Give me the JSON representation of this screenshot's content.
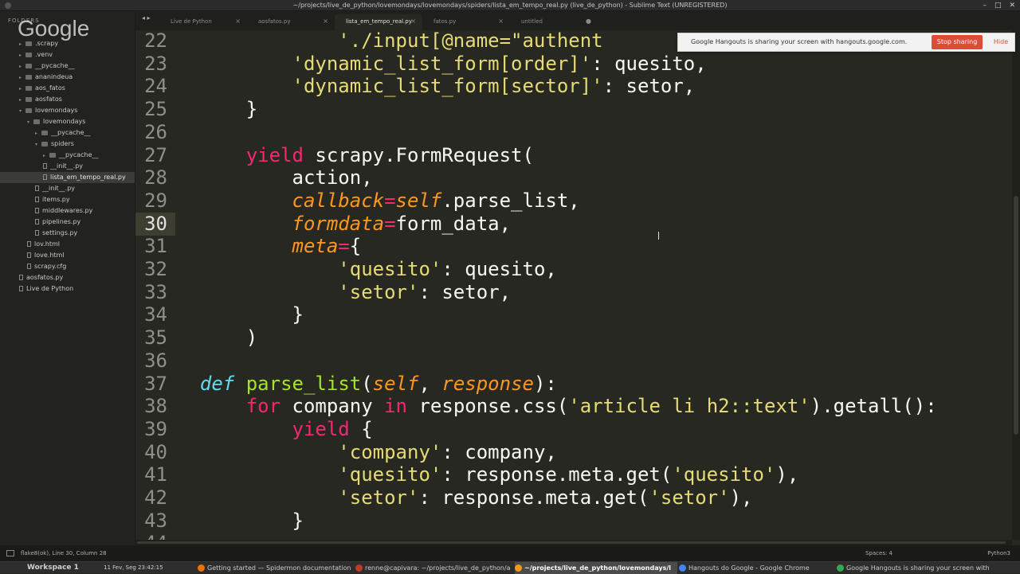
{
  "window": {
    "title": "~/projects/live_de_python/lovemondays/lovemondays/spiders/lista_em_tempo_real.py (live_de_python) - Sublime Text (UNREGISTERED)",
    "controls": [
      "–",
      "□",
      "✕"
    ]
  },
  "sidebar": {
    "header": "FOLDERS",
    "watermark": "Google",
    "items": [
      {
        "label": ".scrapy",
        "type": "folder",
        "indent": 1
      },
      {
        "label": ".venv",
        "type": "folder",
        "indent": 1
      },
      {
        "label": "__pycache__",
        "type": "folder",
        "indent": 1
      },
      {
        "label": "ananindeua",
        "type": "folder",
        "indent": 1
      },
      {
        "label": "aos_fatos",
        "type": "folder",
        "indent": 1
      },
      {
        "label": "aosfatos",
        "type": "folder",
        "indent": 1
      },
      {
        "label": "lovemondays",
        "type": "folder-open",
        "indent": 1
      },
      {
        "label": "lovemondays",
        "type": "folder-open",
        "indent": 2
      },
      {
        "label": "__pycache__",
        "type": "folder",
        "indent": 3
      },
      {
        "label": "spiders",
        "type": "folder-open",
        "indent": 3
      },
      {
        "label": "__pycache__",
        "type": "folder",
        "indent": 4
      },
      {
        "label": "__init__.py",
        "type": "file",
        "indent": 4
      },
      {
        "label": "lista_em_tempo_real.py",
        "type": "file",
        "indent": 4,
        "active": true
      },
      {
        "label": "__init__.py",
        "type": "file",
        "indent": 3
      },
      {
        "label": "items.py",
        "type": "file",
        "indent": 3
      },
      {
        "label": "middlewares.py",
        "type": "file",
        "indent": 3
      },
      {
        "label": "pipelines.py",
        "type": "file",
        "indent": 3
      },
      {
        "label": "settings.py",
        "type": "file",
        "indent": 3
      },
      {
        "label": "lov.html",
        "type": "file",
        "indent": 2
      },
      {
        "label": "love.html",
        "type": "file",
        "indent": 2
      },
      {
        "label": "scrapy.cfg",
        "type": "file",
        "indent": 2
      },
      {
        "label": "aosfatos.py",
        "type": "file",
        "indent": 1
      },
      {
        "label": "Live de Python",
        "type": "file",
        "indent": 1
      }
    ]
  },
  "tabs": [
    {
      "label": "Live de Python",
      "active": false
    },
    {
      "label": "aosfatos.py",
      "active": false
    },
    {
      "label": "lista_em_tempo_real.py",
      "active": true
    },
    {
      "label": "fatos.py",
      "active": false
    },
    {
      "label": "untitled",
      "active": false
    }
  ],
  "notification": {
    "text": "Google Hangouts is sharing your screen with hangouts.google.com.",
    "stop_label": "Stop sharing",
    "hide_label": "Hide"
  },
  "editor": {
    "current_line": 30,
    "lines": [
      {
        "n": "22",
        "html": "            <span class=\"s\">'./input[@name=\"authent</span>"
      },
      {
        "n": "23",
        "html": "        <span class=\"s\">'dynamic_list_form[order]'</span>: quesito,"
      },
      {
        "n": "24",
        "html": "        <span class=\"s\">'dynamic_list_form[sector]'</span>: setor,"
      },
      {
        "n": "25",
        "html": "    }"
      },
      {
        "n": "26",
        "html": ""
      },
      {
        "n": "27",
        "html": "    <span class=\"k\">yield</span> scrapy.FormRequest("
      },
      {
        "n": "28",
        "html": "        action,"
      },
      {
        "n": "29",
        "html": "        <span class=\"p\">callback</span><span class=\"k\">=</span><span class=\"sf\">self</span>.parse_list,"
      },
      {
        "n": "30",
        "html": "        <span class=\"p\">formdata</span><span class=\"k\">=</span>form_data,"
      },
      {
        "n": "31",
        "html": "        <span class=\"p\">meta</span><span class=\"k\">=</span>{"
      },
      {
        "n": "32",
        "html": "            <span class=\"s\">'quesito'</span>: quesito,"
      },
      {
        "n": "33",
        "html": "            <span class=\"s\">'setor'</span>: setor,"
      },
      {
        "n": "34",
        "html": "        }"
      },
      {
        "n": "35",
        "html": "    )"
      },
      {
        "n": "36",
        "html": ""
      },
      {
        "n": "37",
        "html": "<span class=\"n\">def</span> <span class=\"f\">parse_list</span>(<span class=\"sf\">self</span>, <span class=\"sf\">response</span>):"
      },
      {
        "n": "38",
        "html": "    <span class=\"k\">for</span> company <span class=\"k\">in</span> response.css(<span class=\"s\">'article li h2::text'</span>).getall():"
      },
      {
        "n": "39",
        "html": "        <span class=\"k\">yield</span> {"
      },
      {
        "n": "40",
        "html": "            <span class=\"s\">'company'</span>: company,"
      },
      {
        "n": "41",
        "html": "            <span class=\"s\">'quesito'</span>: response.meta.get(<span class=\"s\">'quesito'</span>),"
      },
      {
        "n": "42",
        "html": "            <span class=\"s\">'setor'</span>: response.meta.get(<span class=\"s\">'setor'</span>),"
      },
      {
        "n": "43",
        "html": "        }"
      },
      {
        "n": "44",
        "html": ""
      }
    ]
  },
  "status": {
    "left": "flake8(ok), Line 30, Column 28",
    "spaces": "Spaces: 4",
    "syntax": "Python3"
  },
  "taskbar": {
    "workspace": "Workspace 1",
    "clock": "11 Fev, Seg 23:42:15",
    "tasks": [
      {
        "label": "Getting started — Spidermon documentation",
        "color": "#e8710a"
      },
      {
        "label": "renne@capivara: ~/projects/live_de_python/a",
        "color": "#c0392b"
      },
      {
        "label": "~/projects/live_de_python/lovemondays/l",
        "color": "#f39c12",
        "active": true
      },
      {
        "label": "Hangouts do Google - Google Chrome",
        "color": "#4285f4"
      },
      {
        "label": "Google Hangouts is sharing your screen with",
        "color": "#34a853"
      }
    ]
  }
}
